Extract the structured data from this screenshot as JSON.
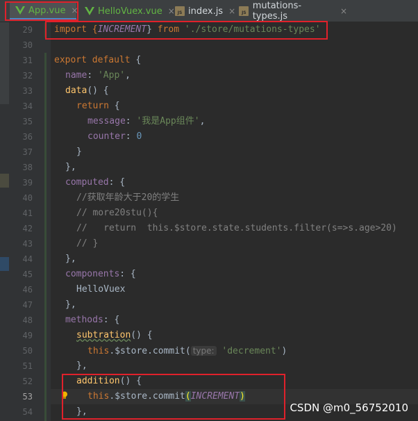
{
  "tabs": [
    {
      "label": "App.vue",
      "type": "vue",
      "active": true
    },
    {
      "label": "HelloVuex.vue",
      "type": "vue",
      "active": false
    },
    {
      "label": "index.js",
      "type": "js",
      "active": false
    },
    {
      "label": "mutations-types.js",
      "type": "js",
      "active": false
    }
  ],
  "js_icon_text": "JS",
  "close_glyph": "×",
  "line_numbers": [
    "29",
    "30",
    "31",
    "32",
    "33",
    "34",
    "35",
    "36",
    "37",
    "38",
    "39",
    "40",
    "41",
    "42",
    "43",
    "44",
    "45",
    "46",
    "47",
    "48",
    "49",
    "50",
    "51",
    "52",
    "53",
    "54"
  ],
  "current_line": "53",
  "code": {
    "l29": {
      "a": "import {",
      "b": "INCREMENT",
      "c": "} ",
      "d": "from",
      "e": " ",
      "f": "'./store/mutations-types'"
    },
    "l31": {
      "a": "export default",
      "b": " {"
    },
    "l32": {
      "a": "name",
      "b": ": ",
      "c": "'App'",
      "d": ","
    },
    "l33": {
      "a": "data",
      "b": "() {"
    },
    "l34": {
      "a": "return",
      "b": " {"
    },
    "l35": {
      "a": "message",
      "b": ": ",
      "c": "'我是App组件'",
      "d": ","
    },
    "l36": {
      "a": "counter",
      "b": ": ",
      "c": "0"
    },
    "l37": {
      "a": "}"
    },
    "l38": {
      "a": "},"
    },
    "l39": {
      "a": "computed",
      "b": ": {"
    },
    "l40": {
      "a": "//获取年龄大于20的学生"
    },
    "l41": {
      "a": "// more20stu(){"
    },
    "l42": {
      "a": "//   return  this.$store.state.students.filter(s=>s.age>20)"
    },
    "l43": {
      "a": "// }"
    },
    "l44": {
      "a": "},"
    },
    "l45": {
      "a": "components",
      "b": ": {"
    },
    "l46": {
      "a": "HelloVuex"
    },
    "l47": {
      "a": "},"
    },
    "l48": {
      "a": "methods",
      "b": ": {"
    },
    "l49": {
      "a": "subtration",
      "b": "() {"
    },
    "l50": {
      "a": "this",
      "b": ".$store.commit(",
      "c": "type:",
      "d": " ",
      "e": "'decrement'",
      "f": ")"
    },
    "l51": {
      "a": "},"
    },
    "l52": {
      "a": "addition",
      "b": "() {"
    },
    "l53": {
      "a": "this",
      "b": ".$store.commit",
      "c": "(",
      "d": "INCREMENT",
      "e": ")"
    },
    "l54": {
      "a": "},"
    }
  },
  "watermark": "CSDN @m0_56752010",
  "colors": {
    "annotation_box": "#e0212b",
    "vue_green": "#62b543",
    "keyword": "#cc7832",
    "string": "#6a8759"
  }
}
